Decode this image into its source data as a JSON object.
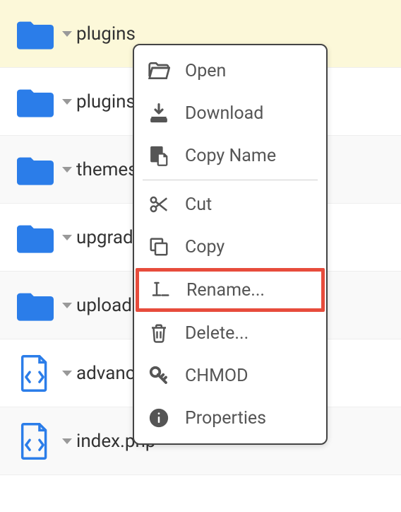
{
  "files": [
    {
      "name": "plugins",
      "type": "folder"
    },
    {
      "name": "plugins",
      "type": "folder"
    },
    {
      "name": "themes",
      "type": "folder"
    },
    {
      "name": "upgrade",
      "type": "folder"
    },
    {
      "name": "uploads",
      "type": "folder"
    },
    {
      "name": "advanced-cache.php",
      "type": "code"
    },
    {
      "name": "index.php",
      "type": "code"
    }
  ],
  "menu": {
    "open": "Open",
    "download": "Download",
    "copyname": "Copy Name",
    "cut": "Cut",
    "copy": "Copy",
    "rename": "Rename...",
    "delete": "Delete...",
    "chmod": "CHMOD",
    "properties": "Properties"
  }
}
